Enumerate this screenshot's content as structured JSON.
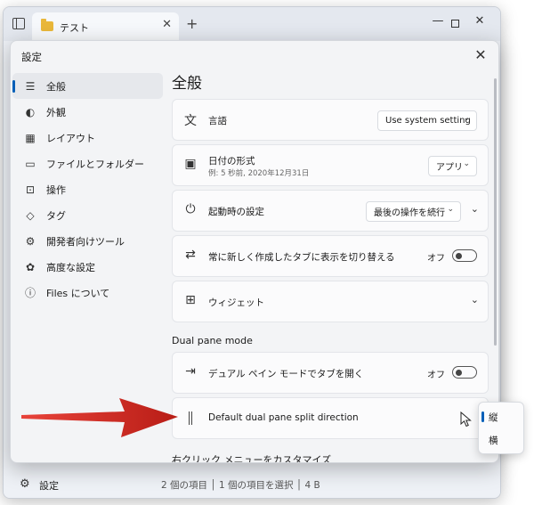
{
  "app": {
    "tab_title": "テスト",
    "tab_close_glyph": "✕",
    "new_tab_glyph": "+",
    "minimize_glyph": "—",
    "close_glyph": "✕"
  },
  "statusbar": {
    "settings_label": "設定",
    "info": "2 個の項目 │ 1 個の項目を選択 │ 4 B"
  },
  "dialog": {
    "title": "設定",
    "close_glyph": "✕",
    "page_heading": "全般"
  },
  "sidebar": {
    "items": [
      {
        "label": "全般",
        "icon": "sliders-icon",
        "glyph": "☰",
        "active": true
      },
      {
        "label": "外観",
        "icon": "palette-icon",
        "glyph": "◐",
        "active": false
      },
      {
        "label": "レイアウト",
        "icon": "grid-icon",
        "glyph": "▦",
        "active": false
      },
      {
        "label": "ファイルとフォルダー",
        "icon": "folder-icon",
        "glyph": "▭",
        "active": false
      },
      {
        "label": "操作",
        "icon": "action-icon",
        "glyph": "⊡",
        "active": false
      },
      {
        "label": "タグ",
        "icon": "tag-icon",
        "glyph": "◇",
        "active": false
      },
      {
        "label": "開発者向けツール",
        "icon": "devtools-icon",
        "glyph": "⚙",
        "active": false
      },
      {
        "label": "高度な設定",
        "icon": "advanced-icon",
        "glyph": "✿",
        "active": false
      },
      {
        "label": "Files について",
        "icon": "info-icon",
        "glyph": "ⓘ",
        "active": false
      }
    ]
  },
  "settings": {
    "language": {
      "label": "言語",
      "value": "Use system setting",
      "icon": "language-icon",
      "glyph": "文"
    },
    "date_format": {
      "label": "日付の形式",
      "sub": "例: 5 秒前, 2020年12月31日",
      "value": "アプリ",
      "icon": "calendar-clock-icon",
      "glyph": "▣"
    },
    "startup": {
      "label": "起動時の設定",
      "value": "最後の操作を続行",
      "icon": "power-icon",
      "glyph": "⏻"
    },
    "switch_tab": {
      "label": "常に新しく作成したタブに表示を切り替える",
      "state": "オフ",
      "icon": "swap-icon",
      "glyph": "⇄"
    },
    "widgets": {
      "label": "ウィジェット",
      "icon": "widgets-icon",
      "glyph": "⊞"
    },
    "dual_pane_heading": "Dual pane mode",
    "dual_pane_open": {
      "label": "デュアル ペイン モードでタブを開く",
      "state": "オフ",
      "icon": "open-pane-icon",
      "glyph": "⇥"
    },
    "split_direction": {
      "label": "Default dual pane split direction"
    },
    "context_menu_heading": "右クリック メニューをカスタマイズ"
  },
  "flyout": {
    "items": [
      {
        "label": "縦",
        "selected": true
      },
      {
        "label": "横",
        "selected": false
      }
    ]
  },
  "colors": {
    "accent": "#005fb8",
    "arrow": "#d42a22"
  }
}
